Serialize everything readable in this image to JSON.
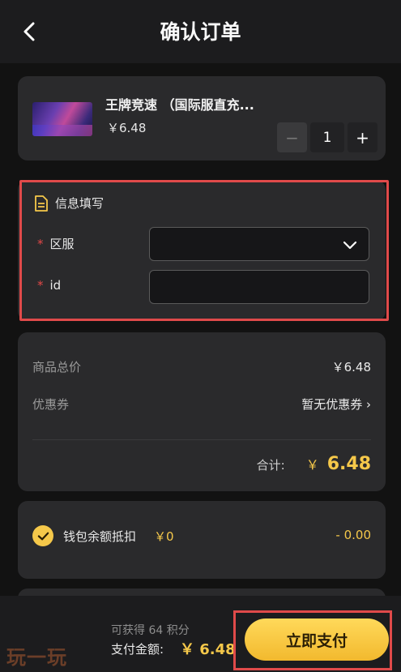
{
  "header": {
    "title": "确认订单"
  },
  "product": {
    "name": "王牌竞速 （国际服直充...",
    "price": "￥6.48",
    "quantity": "1",
    "minus_label": "−",
    "plus_label": "+"
  },
  "info": {
    "heading": "信息填写",
    "fields": [
      {
        "required_mark": "*",
        "label": "区服",
        "value": ""
      },
      {
        "required_mark": "*",
        "label": "id",
        "value": ""
      }
    ]
  },
  "summary": {
    "subtotal_label": "商品总价",
    "subtotal_value": "￥6.48",
    "coupon_label": "优惠券",
    "coupon_value": "暂无优惠券 ›",
    "total_label": "合计:",
    "total_currency": "￥",
    "total_amount": "6.48"
  },
  "wallet": {
    "label": "钱包余额抵扣",
    "balance": "￥0",
    "deduction": "- 0.00"
  },
  "footer": {
    "logo": "玩一玩",
    "points": "可获得 64 积分",
    "pay_label": "支付金额:",
    "pay_amount": "￥ 6.48",
    "pay_button": "立即支付"
  },
  "colors": {
    "accent": "#f5c84a",
    "highlight_border": "#e04a4a",
    "background": "#121212"
  }
}
